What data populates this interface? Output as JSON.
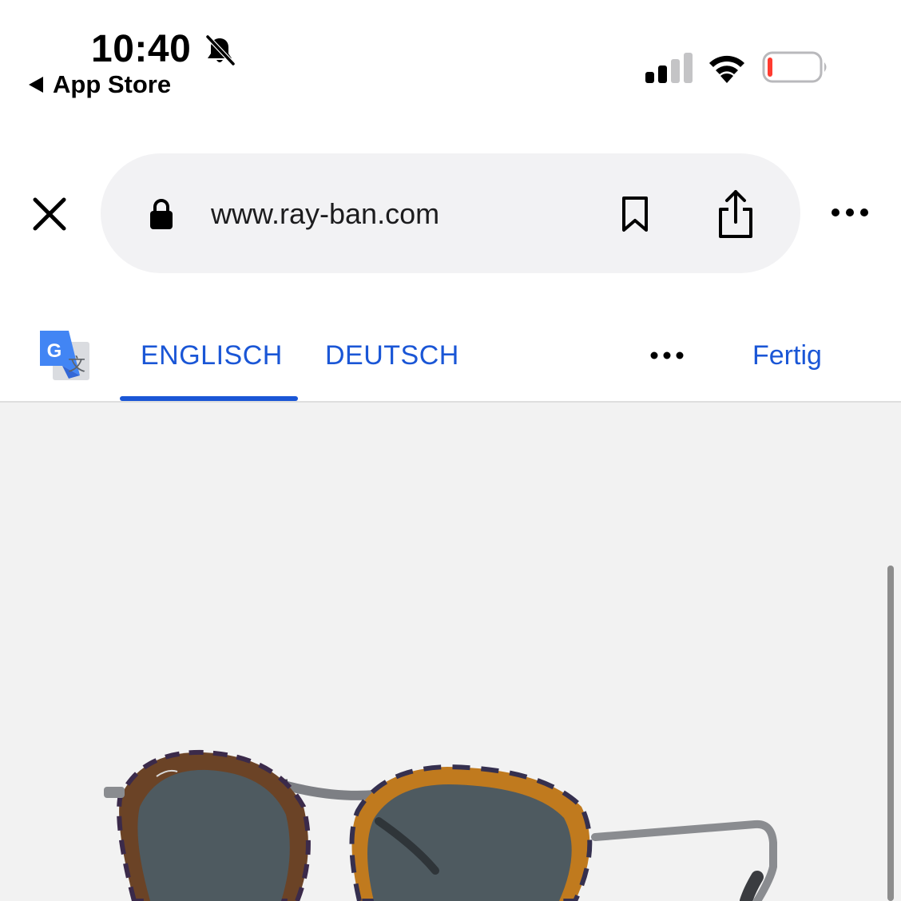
{
  "status_bar": {
    "time": "10:40",
    "back_label": "App Store",
    "icons": [
      "bell-slash-icon",
      "cellular-signal-icon",
      "wifi-icon",
      "battery-low-icon"
    ],
    "signal_bars_active": 2,
    "signal_bars_total": 4,
    "battery_level": 0.05,
    "battery_color": "#ff3b30"
  },
  "browser": {
    "url": "www.ray-ban.com",
    "icons": [
      "close-icon",
      "lock-icon",
      "bookmark-icon",
      "share-icon",
      "more-icon"
    ]
  },
  "translate_bar": {
    "tabs": [
      {
        "label": "ENGLISCH",
        "active": true
      },
      {
        "label": "DEUTSCH",
        "active": false
      }
    ],
    "done_label": "Fertig",
    "accent_color": "#1a56d6",
    "icons": [
      "google-translate-icon",
      "more-options-icon"
    ]
  },
  "content": {
    "background": "#f2f2f2",
    "image": "sunglasses-product-image"
  }
}
